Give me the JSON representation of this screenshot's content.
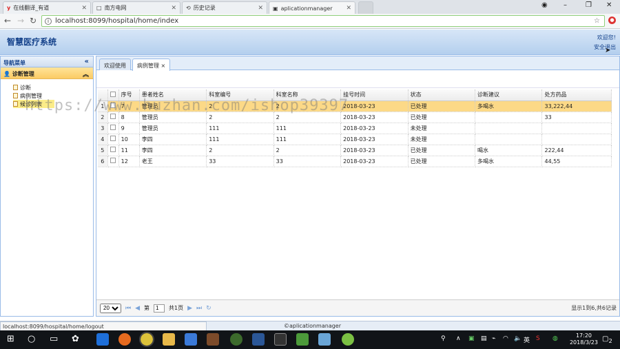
{
  "browser": {
    "tabs": [
      {
        "label": "在线翻译_有道",
        "icon": "y"
      },
      {
        "label": "南方电网",
        "icon": "□"
      },
      {
        "label": "历史记录",
        "icon": "⟲"
      },
      {
        "label": "aplicationmanager",
        "icon": "▣"
      }
    ],
    "url": "localhost:8099/hospital/home/index"
  },
  "header": {
    "title": "智慧医疗系统",
    "hello": "欢迎您!",
    "logout": "安全退出"
  },
  "sidebar": {
    "title": "导航菜单",
    "group": "诊断管理",
    "items": [
      "诊断",
      "病例管理",
      "候诊列表"
    ]
  },
  "main": {
    "tabs": [
      "欢迎使用",
      "病例管理"
    ],
    "table": {
      "headers": [
        "序号",
        "患者姓名",
        "科室编号",
        "科室名称",
        "挂号时间",
        "状态",
        "诊断建议",
        "处方药品"
      ],
      "rows": [
        {
          "rn": "1",
          "id": "7",
          "name": "管理员",
          "dept_no": "2",
          "dept_name": "2",
          "time": "2018-03-23",
          "status": "已处理",
          "advice": "多喝水",
          "drugs": "33,222,44"
        },
        {
          "rn": "2",
          "id": "8",
          "name": "管理员",
          "dept_no": "2",
          "dept_name": "2",
          "time": "2018-03-23",
          "status": "已处理",
          "advice": "",
          "drugs": "33"
        },
        {
          "rn": "3",
          "id": "9",
          "name": "管理员",
          "dept_no": "111",
          "dept_name": "111",
          "time": "2018-03-23",
          "status": "未处理",
          "advice": "",
          "drugs": ""
        },
        {
          "rn": "4",
          "id": "10",
          "name": "李四",
          "dept_no": "111",
          "dept_name": "111",
          "time": "2018-03-23",
          "status": "未处理",
          "advice": "",
          "drugs": ""
        },
        {
          "rn": "5",
          "id": "11",
          "name": "李四",
          "dept_no": "2",
          "dept_name": "2",
          "time": "2018-03-23",
          "status": "已处理",
          "advice": "喝水",
          "drugs": "222,44"
        },
        {
          "rn": "6",
          "id": "12",
          "name": "老王",
          "dept_no": "33",
          "dept_name": "33",
          "time": "2018-03-23",
          "status": "已处理",
          "advice": "多喝水",
          "drugs": "44,55"
        }
      ]
    },
    "pager": {
      "page_size": "20",
      "page_prefix": "第",
      "page_num": "1",
      "page_total": "共1页",
      "info": "显示1到6,共6记录"
    }
  },
  "statusbar": {
    "url": "localhost:8099/hospital/home/logout",
    "copyright": "©aplicationmanager"
  },
  "taskbar": {
    "time": "17:20",
    "date": "2018/3/23",
    "ime": "英",
    "notify": "2"
  },
  "watermark": "https://www.huzhan.com/ishop39397",
  "colors": {
    "highlight_row": "#fcd987",
    "header_blue": "#15428b"
  }
}
